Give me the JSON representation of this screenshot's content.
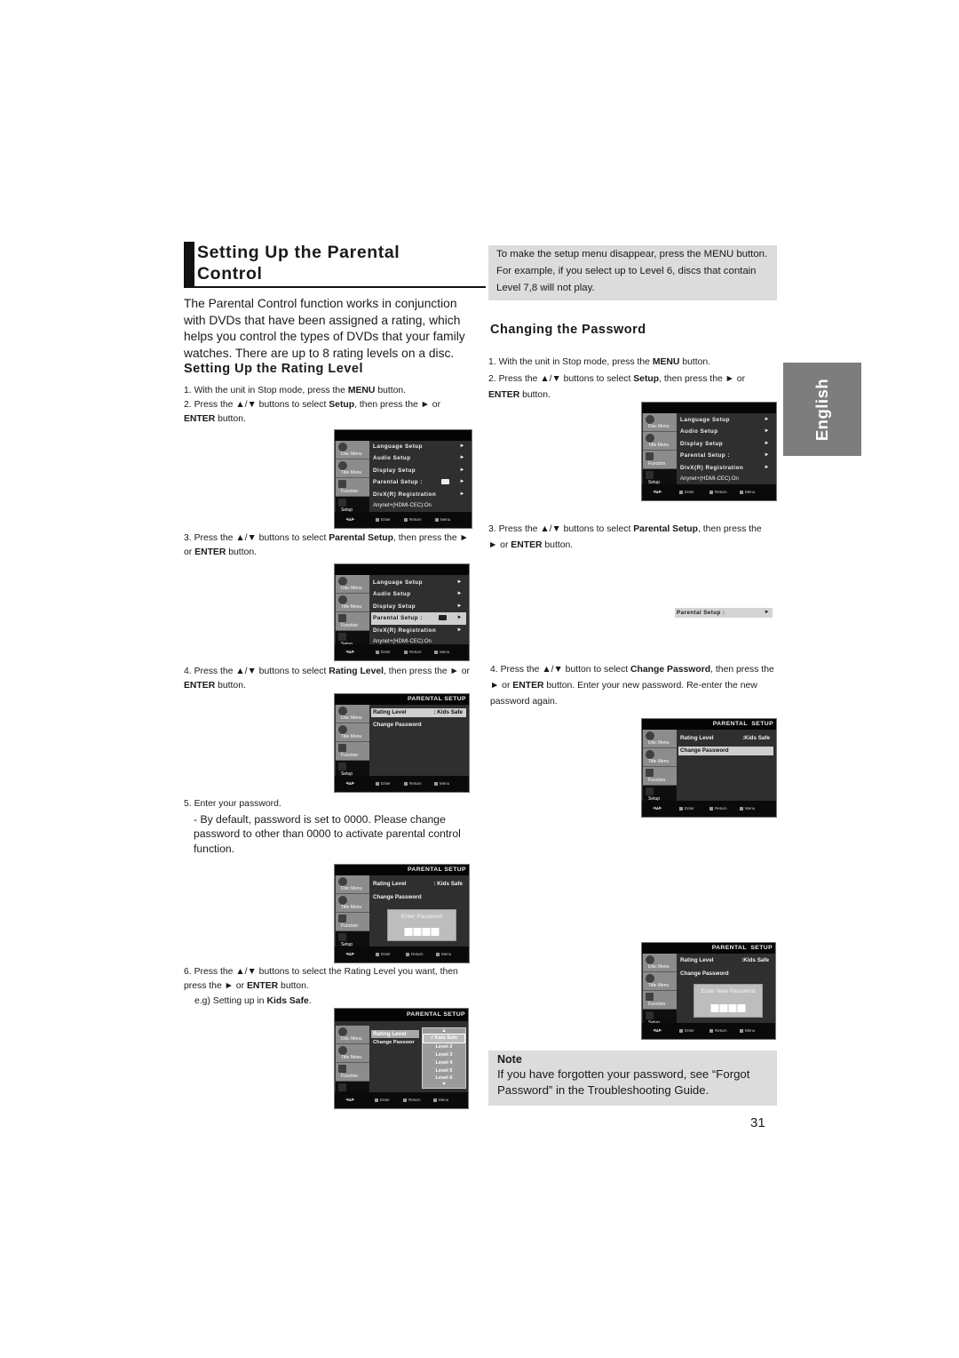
{
  "page": {
    "title": "Setting Up the Parental Control",
    "title_lines": [
      "Setting Up the Parental",
      "Control"
    ],
    "intro": "The Parental Control function works in conjunction with DVDs that have been assigned a rating, which helps you control the types of DVDs that your family watches. There are up to 8 rating levels on a disc.",
    "language_tab": "English",
    "page_number": "31"
  },
  "rating_section": {
    "heading": "Setting Up the Rating Level",
    "steps": [
      {
        "num": "1.",
        "parts": [
          "With the unit in Stop mode, press the ",
          "MENU",
          " button."
        ]
      },
      {
        "num": "2.",
        "parts": [
          "Press the ▲/▼ buttons to select ",
          "Setup",
          ", then press the ► or ",
          "ENTER",
          " button."
        ]
      },
      {
        "num": "3.",
        "parts": [
          "Press the ▲/▼ buttons to select ",
          "Parental Setup",
          ", then press the ► or ",
          "ENTER",
          " button."
        ]
      },
      {
        "num": "4.",
        "parts": [
          "Press the ▲/▼ buttons to select ",
          "Rating Level",
          ", then press the ► or ",
          "ENTER",
          " button."
        ]
      },
      {
        "num": "5.",
        "parts": [
          "Enter your password."
        ]
      },
      {
        "num": "6.",
        "parts": [
          "Press the ▲/▼ buttons to select the Rating Level you want, then press the ► or ",
          "ENTER",
          " button."
        ]
      }
    ],
    "step5_note": "- By default, password is set to 0000. Please change password to other than 0000 to activate parental control function.",
    "step6_example_prefix": "e.g) Setting up in ",
    "step6_example_bold": "Kids Safe",
    "step6_example_suffix": "."
  },
  "info_box": {
    "text": "To make the setup menu disappear, press the MENU button. For example, if you select up to Level 6, discs that contain Level 7,8 will not play."
  },
  "password_section": {
    "heading": "Changing the Password",
    "steps": [
      {
        "num": "1.",
        "parts": [
          "With the unit in Stop mode, press the ",
          "MENU",
          " button."
        ]
      },
      {
        "num": "2.",
        "parts": [
          "Press the ▲/▼ buttons to select ",
          "Setup",
          ", then press the ► or ",
          "ENTER",
          " button."
        ]
      },
      {
        "num": "3.",
        "parts": [
          "Press the ▲/▼ buttons to select ",
          "Parental Setup",
          ", then press the ► or ",
          "ENTER",
          " button."
        ]
      },
      {
        "num": "4.",
        "parts": [
          "Press the ▲/▼ button to select ",
          "Change Password",
          ", then press the ► or ",
          "ENTER",
          " button. Enter your new password. Re-enter the new password again."
        ]
      }
    ]
  },
  "note": {
    "title": "Note",
    "text": "If you have forgotten your password, see “Forgot Password” in the Troubleshooting Guide."
  },
  "menu": {
    "side_tabs": [
      "Disc Menu",
      "Title Menu",
      "Function",
      "Setup"
    ],
    "setup_items": [
      "Language Setup",
      "Audio Setup",
      "Display Setup",
      "Parental Setup :",
      "DivX(R) Registration",
      "Anynet+(HDMI-CEC):On"
    ],
    "arrow": "►",
    "footer": {
      "nav": "◂▴▸",
      "enter": "Enter",
      "return": "Return",
      "menu": "Menu"
    },
    "parental_header": "PARENTAL SETUP",
    "parental_header_spaced": "PARENTAL  SETUP",
    "rating_label": "Rating Level",
    "rating_value": ": Kids Safe",
    "rating_value_compact": ":Kids Safe",
    "change_password": "Change Password",
    "change_password_cut": "Change Passwor",
    "enter_password": "Enter Password",
    "enter_new_password": "Enter New Password",
    "dropdown_up": "▲",
    "dropdown_down": "▼",
    "levels": [
      "√  Kids Safe",
      "Level 2",
      "Level 3",
      "Level 4",
      "Level 5",
      "Level 6"
    ],
    "strip_label": "Parental Setup :"
  }
}
